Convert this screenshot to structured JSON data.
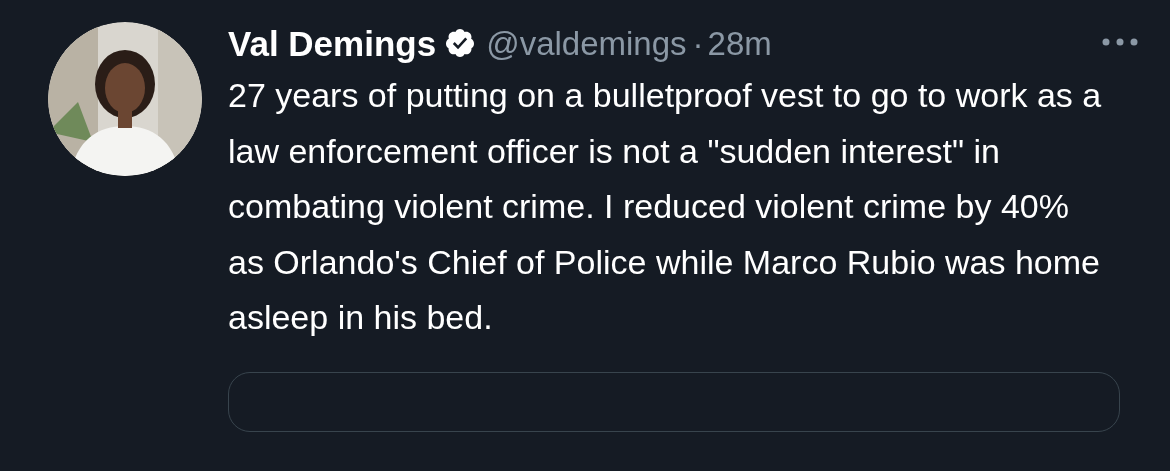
{
  "tweet": {
    "author": {
      "name": "Val Demings",
      "verified": true,
      "handle": "@valdemings",
      "separator": "·",
      "time": "28m"
    },
    "text": "27 years of putting on a bulletproof vest to go to work as a law enforcement officer is not a \"sudden interest\" in combating violent crime. I reduced violent crime by 40% as Orlando's Chief of Police while Marco Rubio was home asleep in his bed.",
    "embedded_card": {
      "kind": "card"
    }
  }
}
